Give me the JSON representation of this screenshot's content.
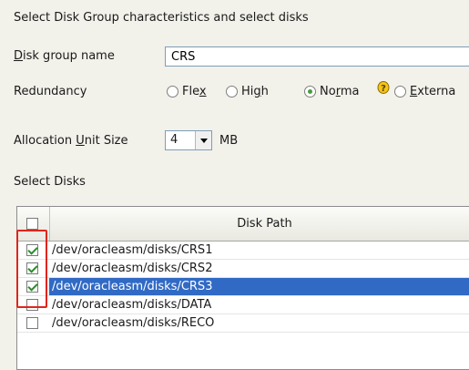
{
  "header": {
    "instruction": "Select Disk Group characteristics and select disks"
  },
  "disk_group_name": {
    "label_pre": "",
    "label_mnemonic": "D",
    "label_post": "isk group name",
    "value": "CRS"
  },
  "redundancy": {
    "label": "Redundancy",
    "options": [
      {
        "pre": "Fle",
        "mn": "x",
        "post": "",
        "selected": false
      },
      {
        "pre": "Hi",
        "mn": "g",
        "post": "h",
        "selected": false
      },
      {
        "pre": "No",
        "mn": "r",
        "post": "ma",
        "selected": true
      },
      {
        "pre": "",
        "mn": "E",
        "post": "xterna",
        "selected": false
      }
    ]
  },
  "allocation": {
    "label_pre": "Allocation ",
    "label_mnemonic": "U",
    "label_post": "nit Size",
    "value": "4",
    "unit": "MB"
  },
  "select_disks": {
    "label": "Select Disks"
  },
  "table": {
    "header_checked": false,
    "column_title": "Disk Path",
    "rows": [
      {
        "path": "/dev/oracleasm/disks/CRS1",
        "checked": true,
        "selected": false
      },
      {
        "path": "/dev/oracleasm/disks/CRS2",
        "checked": true,
        "selected": false
      },
      {
        "path": "/dev/oracleasm/disks/CRS3",
        "checked": true,
        "selected": true
      },
      {
        "path": "/dev/oracleasm/disks/DATA",
        "checked": false,
        "selected": false
      },
      {
        "path": "/dev/oracleasm/disks/RECO",
        "checked": false,
        "selected": false
      }
    ]
  },
  "colors": {
    "selection": "#316ac5",
    "annotation": "#e0251b",
    "check": "#2e8b2e"
  }
}
